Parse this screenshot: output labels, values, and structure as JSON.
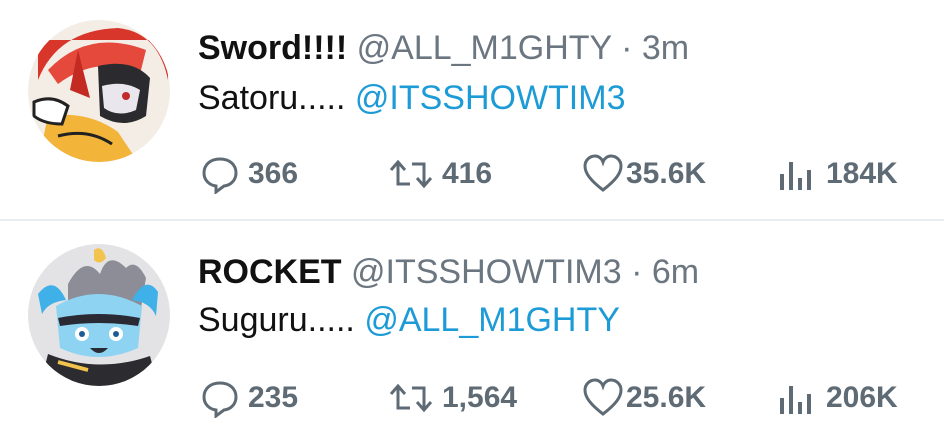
{
  "tweets": [
    {
      "name": "Sword!!!!",
      "handle": "@ALL_M1GHTY",
      "separator": "·",
      "time": "3m",
      "text": "Satoru.....",
      "mention": "@ITSSHOWTIM3",
      "replies": "366",
      "retweets": "416",
      "likes": "35.6K",
      "views": "184K",
      "avatar_icon": "masked-red-character-avatar"
    },
    {
      "name": "ROCKET",
      "handle": "@ITSSHOWTIM3",
      "separator": "·",
      "time": "6m",
      "text": "Suguru.....",
      "mention": "@ALL_M1GHTY",
      "replies": "235",
      "retweets": "1,564",
      "likes": "25.6K",
      "views": "206K",
      "avatar_icon": "blue-flame-character-avatar"
    }
  ],
  "colors": {
    "name": "#111111",
    "meta": "#6b7680",
    "mention": "#1d9bd6",
    "action": "#5f6b74",
    "divider": "#e6ecf0"
  },
  "icons": [
    "reply-icon",
    "retweet-icon",
    "like-icon",
    "views-icon"
  ]
}
